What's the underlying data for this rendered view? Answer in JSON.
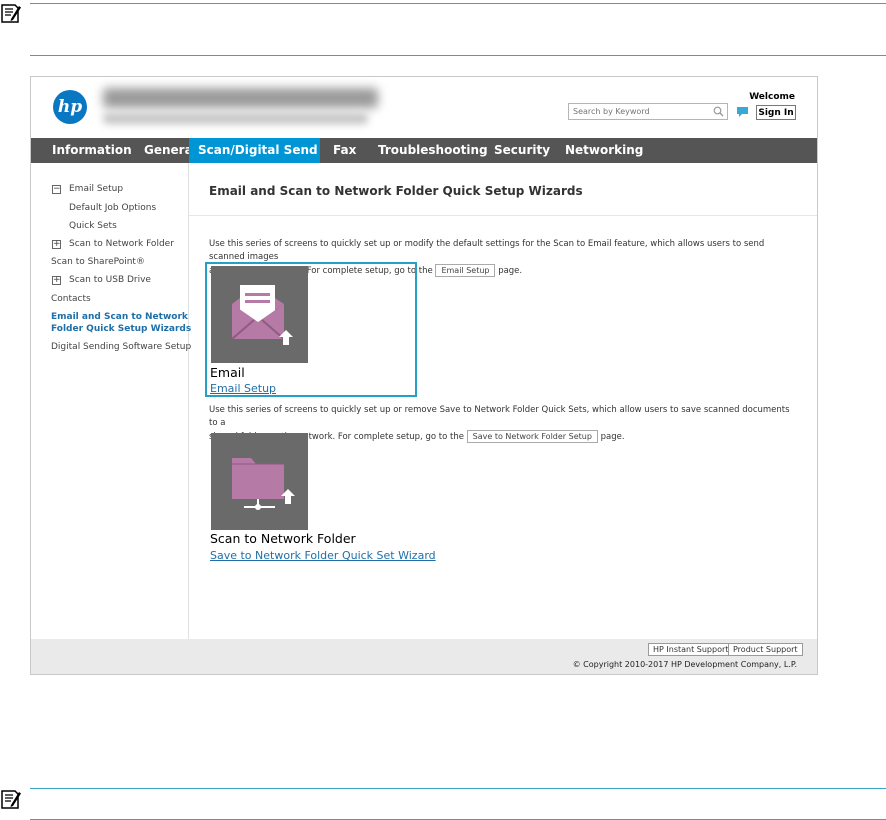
{
  "header": {
    "logo_text": "hp",
    "welcome": "Welcome",
    "search_placeholder": "Search by Keyword",
    "sign_in": "Sign In"
  },
  "nav": [
    {
      "label": "Information"
    },
    {
      "label": "General"
    },
    {
      "label": "Scan/Digital Send",
      "active": true
    },
    {
      "label": "Fax"
    },
    {
      "label": "Troubleshooting"
    },
    {
      "label": "Security"
    },
    {
      "label": "Networking"
    }
  ],
  "sidebar": [
    {
      "label": "Email Setup",
      "expander": "−"
    },
    {
      "label": "Default Job Options"
    },
    {
      "label": "Quick Sets"
    },
    {
      "label": "Scan to Network Folder",
      "expander": "+"
    },
    {
      "label": "Scan to SharePoint®"
    },
    {
      "label": "Scan to USB Drive",
      "expander": "+"
    },
    {
      "label": "Contacts"
    },
    {
      "label": "Email and Scan to Network",
      "active": true
    },
    {
      "label": "Folder Quick Setup Wizards",
      "active": true
    },
    {
      "label": "Digital Sending Software Setup"
    }
  ],
  "main": {
    "title": "Email and Scan to Network Folder Quick Setup Wizards",
    "email": {
      "desc_line1": "Use this series of screens to quickly set up or modify the default settings for the Scan to Email feature, which allows users to send scanned images",
      "desc_line2_pre": "as email attachments. For complete setup, go to the",
      "desc_button": "Email Setup",
      "desc_line2_post": "page.",
      "card_title": "Email",
      "card_link": "Email Setup"
    },
    "folder": {
      "desc_line1": "Use this series of screens to quickly set up or remove Save to Network Folder Quick Sets, which allow users to save scanned documents to a",
      "desc_line2_pre": "shared folder on the network. For complete setup, go to the",
      "desc_button": "Save to Network Folder Setup",
      "desc_line2_post": "page.",
      "card_title": "Scan to Network Folder",
      "card_link": "Save to Network Folder Quick Set Wizard"
    }
  },
  "footer": {
    "instant_support": "HP Instant Support",
    "product_support": "Product Support",
    "copyright": "© Copyright 2010-2017 HP Development Company, L.P."
  },
  "colors": {
    "nav_bg": "#555555",
    "nav_active": "#0096d6",
    "link": "#1e6fa8",
    "tile_bg": "#6a6a6a",
    "tile_icon": "#b57aa5",
    "highlight": "#25a1c8"
  }
}
